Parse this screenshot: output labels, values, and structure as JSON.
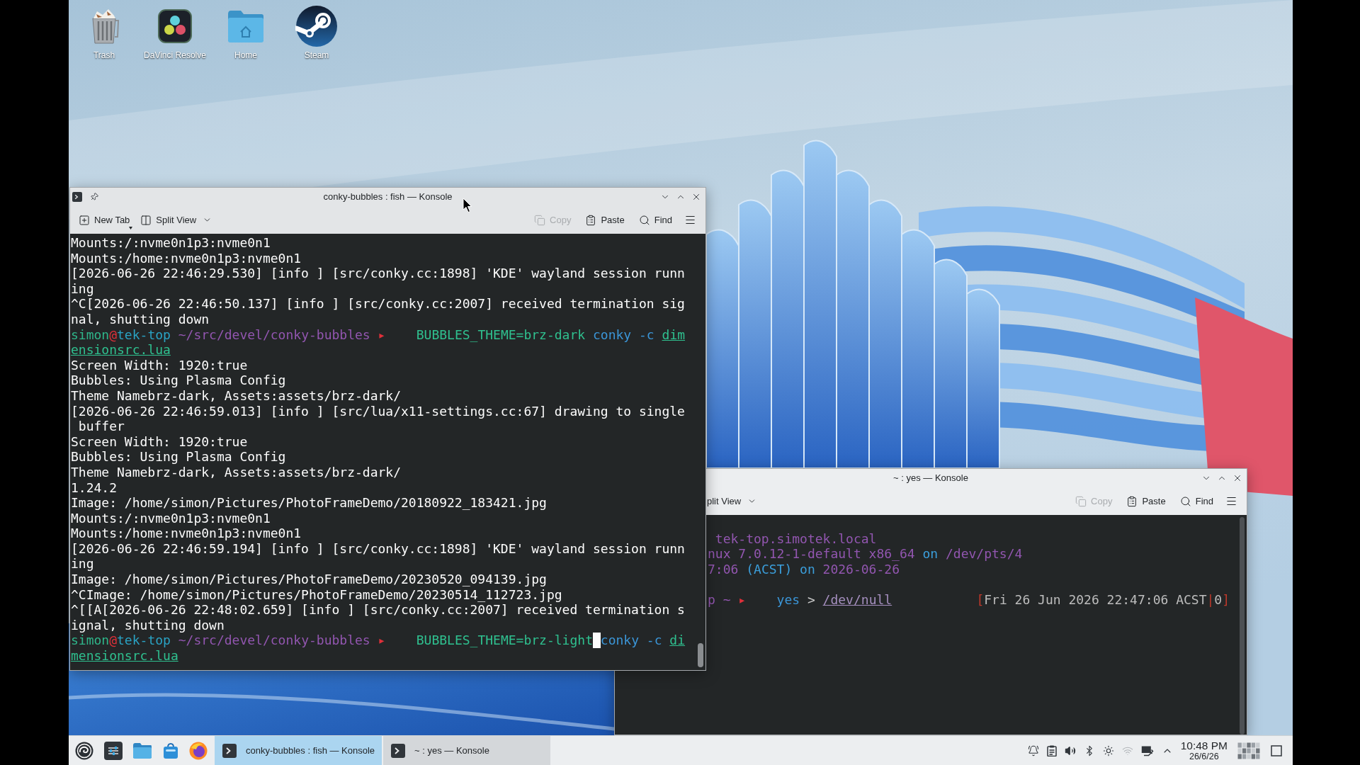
{
  "desktop": {
    "icons": [
      {
        "label": "Trash",
        "kind": "trash"
      },
      {
        "label": "DaVinci Resolve",
        "kind": "resolve"
      },
      {
        "label": "Home",
        "kind": "home"
      },
      {
        "label": "Steam",
        "kind": "steam"
      }
    ]
  },
  "back_window": {
    "title": "~ : yes — Konsole",
    "toolbar_left": [
      {
        "label": "plit View",
        "kind": "split-view"
      }
    ],
    "toolbar_right": [
      {
        "label": "Copy",
        "kind": "copy",
        "disabled": true
      },
      {
        "label": "Paste",
        "kind": "paste",
        "disabled": false
      },
      {
        "label": "Find",
        "kind": "find",
        "disabled": false
      }
    ],
    "terminal": {
      "rows": [
        {
          "kind": "blank"
        },
        {
          "kind": "styled",
          "segments": [
            {
              "text": " tek-top.simotek.local",
              "kind": "value"
            }
          ]
        },
        {
          "kind": "styled",
          "segments": [
            {
              "text": "nux 7.0.12-1-default x86_64",
              "kind": "value"
            },
            {
              "text": " on",
              "kind": "keyword"
            },
            {
              "text": " /dev/pts/4",
              "kind": "value"
            }
          ]
        },
        {
          "kind": "styled",
          "segments": [
            {
              "text": "7:06",
              "kind": "value"
            },
            {
              "text": " (ACST) on",
              "kind": "keyword"
            },
            {
              "text": " 2026-06-26",
              "kind": "value"
            }
          ]
        },
        {
          "kind": "blank"
        },
        {
          "kind": "styled",
          "segments": [
            {
              "text": "p ~",
              "kind": "path"
            },
            {
              "text": " ▸",
              "kind": "arrow"
            },
            {
              "text": "    yes",
              "kind": "command"
            },
            {
              "text": " >",
              "kind": "operator"
            },
            {
              "text": " /dev/null",
              "kind": "device"
            },
            {
              "text": "           [",
              "kind": "bracket"
            },
            {
              "text": "Fri 26 Jun 2026 22:47:06 ACST",
              "kind": "muted"
            },
            {
              "text": "|",
              "kind": "bracket"
            },
            {
              "text": "0",
              "kind": "muted"
            },
            {
              "text": "]",
              "kind": "bracket"
            }
          ]
        }
      ]
    }
  },
  "front_window": {
    "title": "conky-bubbles : fish — Konsole",
    "toolbar_left": [
      {
        "label": "New Tab",
        "kind": "new-tab"
      },
      {
        "label": "Split View",
        "kind": "split-view"
      }
    ],
    "toolbar_right": [
      {
        "label": "Copy",
        "kind": "copy",
        "disabled": true
      },
      {
        "label": "Paste",
        "kind": "paste",
        "disabled": false
      },
      {
        "label": "Find",
        "kind": "find",
        "disabled": false
      }
    ],
    "terminal": {
      "rows": [
        {
          "kind": "output",
          "text": "Mounts:/:nvme0n1p3:nvme0n1"
        },
        {
          "kind": "output",
          "text": "Mounts:/home:nvme0n1p3:nvme0n1"
        },
        {
          "kind": "output",
          "text": "[2026-06-26 22:46:29.530] [info ] [src/conky.cc:1898] 'KDE' wayland session runn"
        },
        {
          "kind": "output",
          "text": "ing"
        },
        {
          "kind": "output",
          "text": "^C[2026-06-26 22:46:50.137] [info ] [src/conky.cc:2007] received termination sig"
        },
        {
          "kind": "output",
          "text": "nal, shutting down"
        },
        {
          "kind": "styled",
          "segments": [
            {
              "text": "simon",
              "kind": "user"
            },
            {
              "text": "@",
              "kind": "at"
            },
            {
              "text": "tek-top",
              "kind": "host"
            },
            {
              "text": " ~/src/devel/conky-bubbles",
              "kind": "path"
            },
            {
              "text": " ▸",
              "kind": "arrow"
            },
            {
              "text": "    BUBBLES_THEME=brz-dark",
              "kind": "env"
            },
            {
              "text": " conky",
              "kind": "command"
            },
            {
              "text": " -c",
              "kind": "option"
            },
            {
              "text": " dim",
              "kind": "file"
            }
          ]
        },
        {
          "kind": "styled",
          "segments": [
            {
              "text": "ensionsrc.lua",
              "kind": "file"
            }
          ]
        },
        {
          "kind": "output",
          "text": "Screen Width: 1920:true"
        },
        {
          "kind": "output",
          "text": "Bubbles: Using Plasma Config"
        },
        {
          "kind": "output",
          "text": "Theme Namebrz-dark, Assets:assets/brz-dark/"
        },
        {
          "kind": "output",
          "text": "[2026-06-26 22:46:59.013] [info ] [src/lua/x11-settings.cc:67] drawing to single"
        },
        {
          "kind": "output",
          "text": " buffer"
        },
        {
          "kind": "output",
          "text": "Screen Width: 1920:true"
        },
        {
          "kind": "output",
          "text": "Bubbles: Using Plasma Config"
        },
        {
          "kind": "output",
          "text": "Theme Namebrz-dark, Assets:assets/brz-dark/"
        },
        {
          "kind": "output",
          "text": "1.24.2"
        },
        {
          "kind": "output",
          "text": "Image: /home/simon/Pictures/PhotoFrameDemo/20180922_183421.jpg"
        },
        {
          "kind": "output",
          "text": "Mounts:/:nvme0n1p3:nvme0n1"
        },
        {
          "kind": "output",
          "text": "Mounts:/home:nvme0n1p3:nvme0n1"
        },
        {
          "kind": "output",
          "text": "[2026-06-26 22:46:59.194] [info ] [src/conky.cc:1898] 'KDE' wayland session runn"
        },
        {
          "kind": "output",
          "text": "ing"
        },
        {
          "kind": "output",
          "text": "Image: /home/simon/Pictures/PhotoFrameDemo/20230520_094139.jpg"
        },
        {
          "kind": "output",
          "text": "^CImage: /home/simon/Pictures/PhotoFrameDemo/20230514_112723.jpg"
        },
        {
          "kind": "output",
          "text": "^[[A[2026-06-26 22:48:02.659] [info ] [src/conky.cc:2007] received termination s"
        },
        {
          "kind": "output",
          "text": "ignal, shutting down"
        },
        {
          "kind": "styled",
          "segments": [
            {
              "text": "simon",
              "kind": "user"
            },
            {
              "text": "@",
              "kind": "at"
            },
            {
              "text": "tek-top",
              "kind": "host"
            },
            {
              "text": " ~/src/devel/conky-bubbles",
              "kind": "path"
            },
            {
              "text": " ▸",
              "kind": "arrow"
            },
            {
              "text": "    BUBBLES_THEME=brz-light",
              "kind": "env"
            },
            {
              "kind": "cursor"
            },
            {
              "text": "conky",
              "kind": "command"
            },
            {
              "text": " -c",
              "kind": "option"
            },
            {
              "text": " di",
              "kind": "file"
            }
          ]
        },
        {
          "kind": "styled",
          "segments": [
            {
              "text": "mensionsrc.lua",
              "kind": "file"
            }
          ]
        }
      ]
    }
  },
  "taskbar": {
    "tasks": [
      {
        "label": "conky-bubbles : fish — Konsole",
        "selected": true
      },
      {
        "label": "~ : yes — Konsole",
        "selected": false
      }
    ],
    "clock": {
      "time": "10:48 PM",
      "date": "26/6/26"
    }
  }
}
